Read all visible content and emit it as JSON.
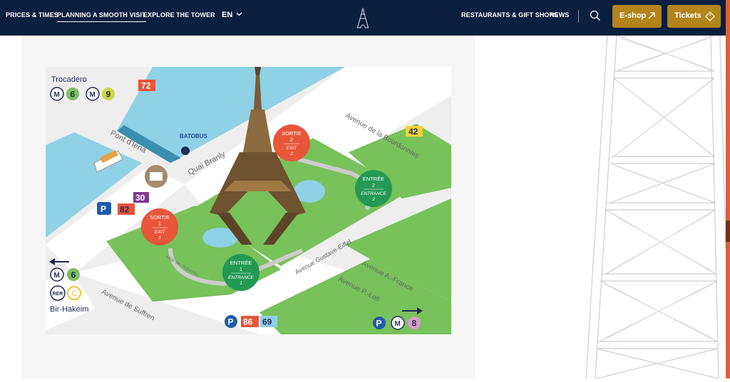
{
  "nav": {
    "left_items": [
      {
        "label": "PRICES & TIMES"
      },
      {
        "label": "PLANNING A SMOOTH VISIT"
      },
      {
        "label": "EXPLORE"
      },
      {
        "label": "THE TOWER"
      }
    ],
    "language": "EN",
    "right_items": [
      {
        "label": "RESTAURANTS & GIFT SHOPS"
      },
      {
        "label": "NEWS"
      }
    ],
    "eshop_label": "E-shop",
    "tickets_label": "Tickets"
  },
  "colors": {
    "nav_bg": "#0b1f3f",
    "button_bg": "#b3841a",
    "accent_strip": "#d9613b",
    "water": "#8fd1e5",
    "grass": "#77c25a",
    "exit": "#e8563a",
    "entrance": "#229a52"
  },
  "map": {
    "trocadero": "Trocadéro",
    "metro_trocadero_lines": [
      "6",
      "9"
    ],
    "bus_72": "72",
    "bus_42": "42",
    "bus_30": "30",
    "bus_82": "82",
    "bus_86": "86",
    "bus_69": "69",
    "metro_8": "8",
    "bir_hakeim": "Bir-Hakeim",
    "metro_bir_hakeim": "6",
    "rer_c": "C",
    "batobus": "BATOBUS",
    "streets": {
      "pont_iena": "Pont d'Iéna",
      "quai_branly": "Quai Branly",
      "bourdonnais": "Avenue de la Bourdonnais",
      "gustave_eiffel": "Avenue Gustave-Eiffel",
      "a_france": "Avenue A.-France",
      "p_loti": "Avenue P.-Loti",
      "suffren": "Avenue de Suffren",
      "allee_refuzniks": "Allée des Refuzniks"
    },
    "markers": [
      {
        "l1": "SORTIE",
        "l2": "2",
        "l3": "EXIT",
        "l4": "2"
      },
      {
        "l1": "ENTRÉE",
        "l2": "2",
        "l3": "ENTRANCE",
        "l4": "2"
      },
      {
        "l1": "SORTIE",
        "l2": "1",
        "l3": "EXIT",
        "l4": "1"
      },
      {
        "l1": "ENTRÉE",
        "l2": "1",
        "l3": "ENTRANCE",
        "l4": "1"
      }
    ]
  }
}
